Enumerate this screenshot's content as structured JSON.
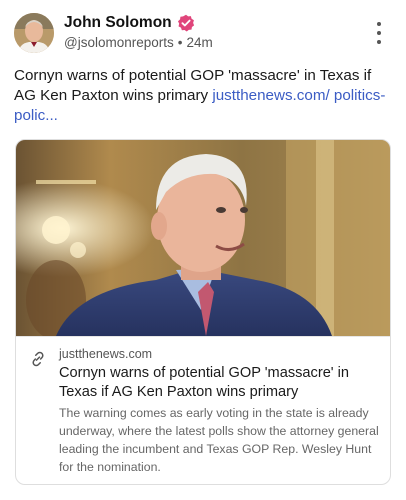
{
  "author": {
    "name": "John Solomon",
    "handle": "@jsolomonreports",
    "separator": "•",
    "time": "24m",
    "verified_color": "#e0457b"
  },
  "post": {
    "text": "Cornyn warns of potential GOP 'massacre' in Texas if AG Ken Paxton wins primary ",
    "link_text": "justthenews.com/ politics-polic..."
  },
  "card": {
    "domain": "justthenews.com",
    "title": "Cornyn warns of potential GOP 'massacre' in Texas if AG Ken Paxton wins primary",
    "description": "The warning comes as early voting in the state is already underway, where the latest polls show the attorney general leading the incumbent and Texas GOP Rep. Wesley Hunt for the nomination."
  },
  "icons": {
    "verified": "verified-badge-icon",
    "more": "more-vertical-icon",
    "link": "link-icon"
  },
  "colors": {
    "link": "#3b5cc4",
    "muted": "#666666"
  }
}
